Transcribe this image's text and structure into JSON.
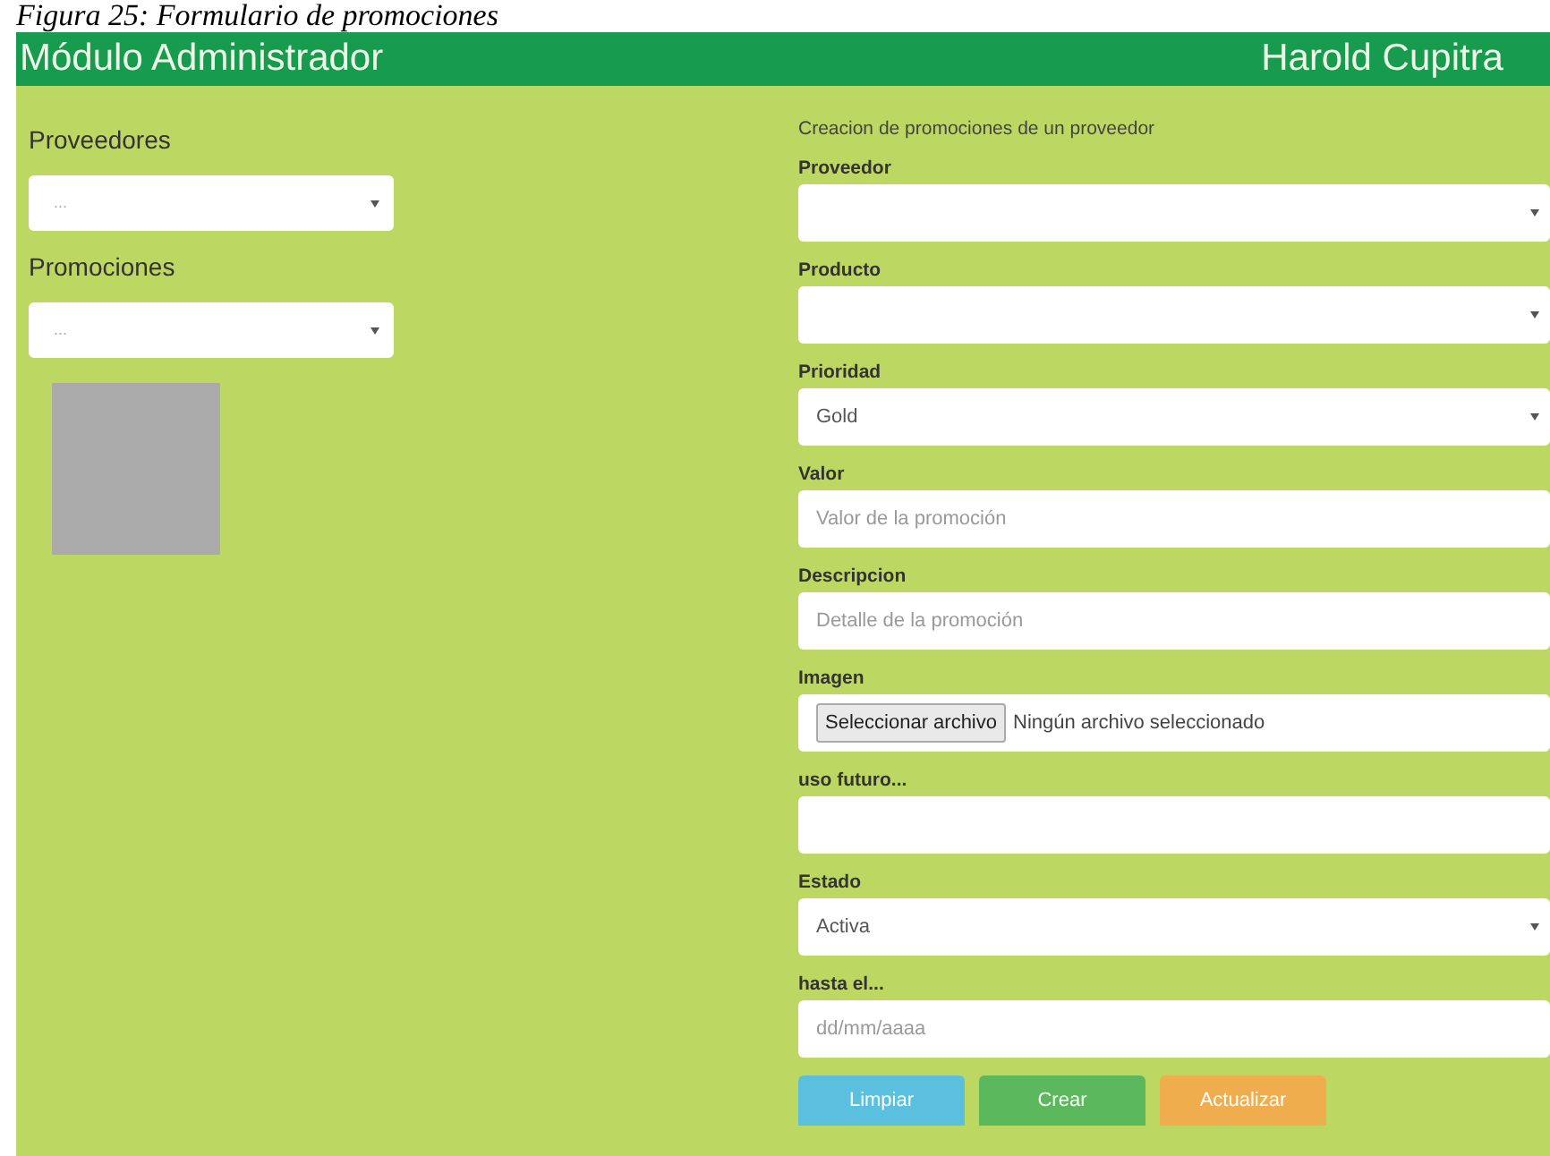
{
  "caption": "Figura 25: Formulario de promociones",
  "header": {
    "title": "Módulo Administrador",
    "user": "Harold Cupitra"
  },
  "left": {
    "fields": [
      {
        "label": "Proveedores",
        "placeholder": "..."
      },
      {
        "label": "Promociones",
        "placeholder": "..."
      }
    ]
  },
  "right": {
    "heading": "Creacion de promociones de un proveedor",
    "fields": [
      {
        "kind": "select",
        "label": "Proveedor"
      },
      {
        "kind": "select",
        "label": "Producto"
      },
      {
        "kind": "select",
        "label": "Prioridad",
        "value": "Gold"
      },
      {
        "kind": "text",
        "label": "Valor",
        "placeholder": "Valor de la promoción"
      },
      {
        "kind": "text",
        "label": "Descripcion",
        "placeholder": "Detalle de la promoción"
      },
      {
        "kind": "file",
        "label": "Imagen",
        "button_label": "Seleccionar archivo",
        "status": "Ningún archivo seleccionado"
      },
      {
        "kind": "text",
        "label": "uso futuro..."
      },
      {
        "kind": "select",
        "label": "Estado",
        "value": "Activa"
      },
      {
        "kind": "date",
        "label": "hasta el...",
        "placeholder": "dd/mm/aaaa"
      }
    ],
    "buttons": [
      {
        "label": "Limpiar",
        "kind": "info"
      },
      {
        "label": "Crear",
        "kind": "success"
      },
      {
        "label": "Actualizar",
        "kind": "warning"
      }
    ]
  }
}
